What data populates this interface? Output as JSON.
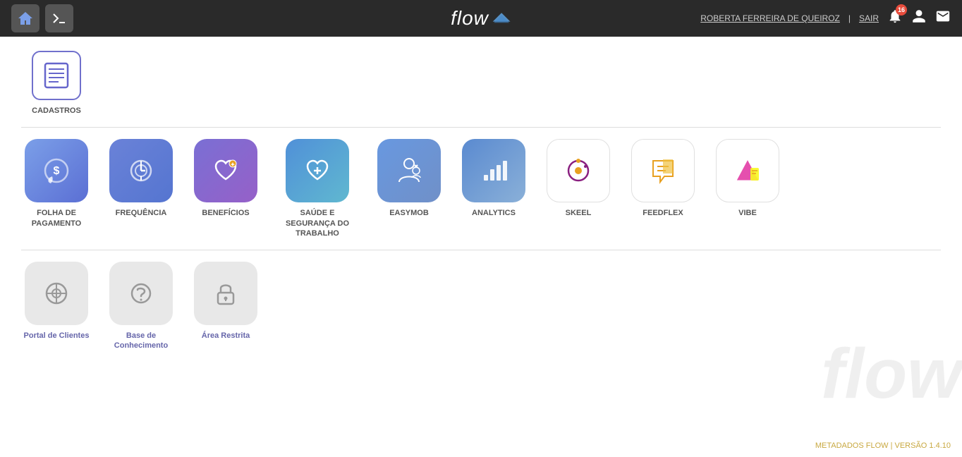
{
  "header": {
    "logo_text": "flow",
    "user_name": "ROBERTA FERREIRA DE QUEIROZ",
    "separator": "|",
    "sair": "SAIR",
    "notification_count": "16"
  },
  "sections": {
    "cadastros": {
      "label": "CADASTROS"
    },
    "apps": [
      {
        "id": "folha",
        "label": "FOLHA DE\nPAGAMENTO",
        "bg": "blue-purple"
      },
      {
        "id": "frequencia",
        "label": "FREQUÊNCIA",
        "bg": "purple-blue"
      },
      {
        "id": "beneficios",
        "label": "BENEFÍCIOS",
        "bg": "purple-pink"
      },
      {
        "id": "saude",
        "label": "SAÚDE E\nSEGURANÇA DO\nTRABALHO",
        "bg": "blue-cyan"
      },
      {
        "id": "easymob",
        "label": "EASYMOB",
        "bg": "blue-slate"
      },
      {
        "id": "analytics",
        "label": "ANALYTICS",
        "bg": "blue-grad"
      },
      {
        "id": "skeel",
        "label": "SKEEL",
        "bg": "white-border"
      },
      {
        "id": "feedflex",
        "label": "FEEDFLEX",
        "bg": "yellow-orange"
      },
      {
        "id": "vibe",
        "label": "VIBE",
        "bg": "white-pink"
      }
    ],
    "tools": [
      {
        "id": "portal",
        "label": "Portal de Clientes"
      },
      {
        "id": "base",
        "label": "Base de\nConhecimento"
      },
      {
        "id": "restrita",
        "label": "Área Restrita"
      }
    ]
  },
  "footer": {
    "text": "METADADOS FLOW | VERSÃO 1.4.10"
  }
}
